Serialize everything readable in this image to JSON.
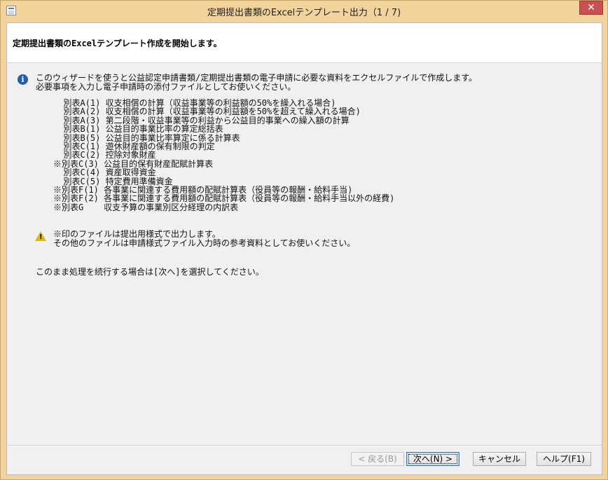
{
  "window": {
    "title": "定期提出書類のExcelテンプレート出力（1 / 7)",
    "close_label": "✕"
  },
  "header": {
    "text": "定期提出書類のExcelテンプレート作成を開始します。"
  },
  "intro": {
    "line1": "このウィザードを使うと公益認定申請書類/定期提出書類の電子申請に必要な資料をエクセルファイルで作成します。",
    "line2": "必要事項を入力し電子申請時の添付ファイルとしてお使いください。"
  },
  "forms": [
    "  別表A(1) 収支相償の計算（収益事業等の利益額の50%を繰入れる場合)",
    "  別表A(2) 収支相償の計算（収益事業等の利益額を50%を超えて繰入れる場合)",
    "  別表A(3) 第二段階・収益事業等の利益から公益目的事業への繰入額の計算",
    "  別表B(1) 公益目的事業比率の算定総括表",
    "  別表B(5) 公益目的事業比率算定に係る計算表",
    "  別表C(1) 遊休財産額の保有制限の判定",
    "  別表C(2) 控除対象財産",
    "※別表C(3) 公益目的保有財産配賦計算表",
    "  別表C(4) 資産取得資金",
    "  別表C(5) 特定費用準備資金",
    "※別表F(1) 各事業に関連する費用額の配賦計算表（役員等の報酬・給料手当)",
    "※別表F(2) 各事業に関連する費用額の配賦計算表（役員等の報酬・給料手当以外の経費)",
    "※別表G    収支予算の事業別区分経理の内訳表"
  ],
  "note": {
    "line1": "※印のファイルは提出用様式で出力します。",
    "line2": "その他のファイルは申請様式ファイル入力時の参考資料としてお使いください。"
  },
  "instruction": "このまま処理を続行する場合は[次へ]を選択してください。",
  "buttons": {
    "back": "< 戻る(B)",
    "next": "次へ(N) >",
    "cancel": "キャンセル",
    "help": "ヘルプ(F1)"
  }
}
